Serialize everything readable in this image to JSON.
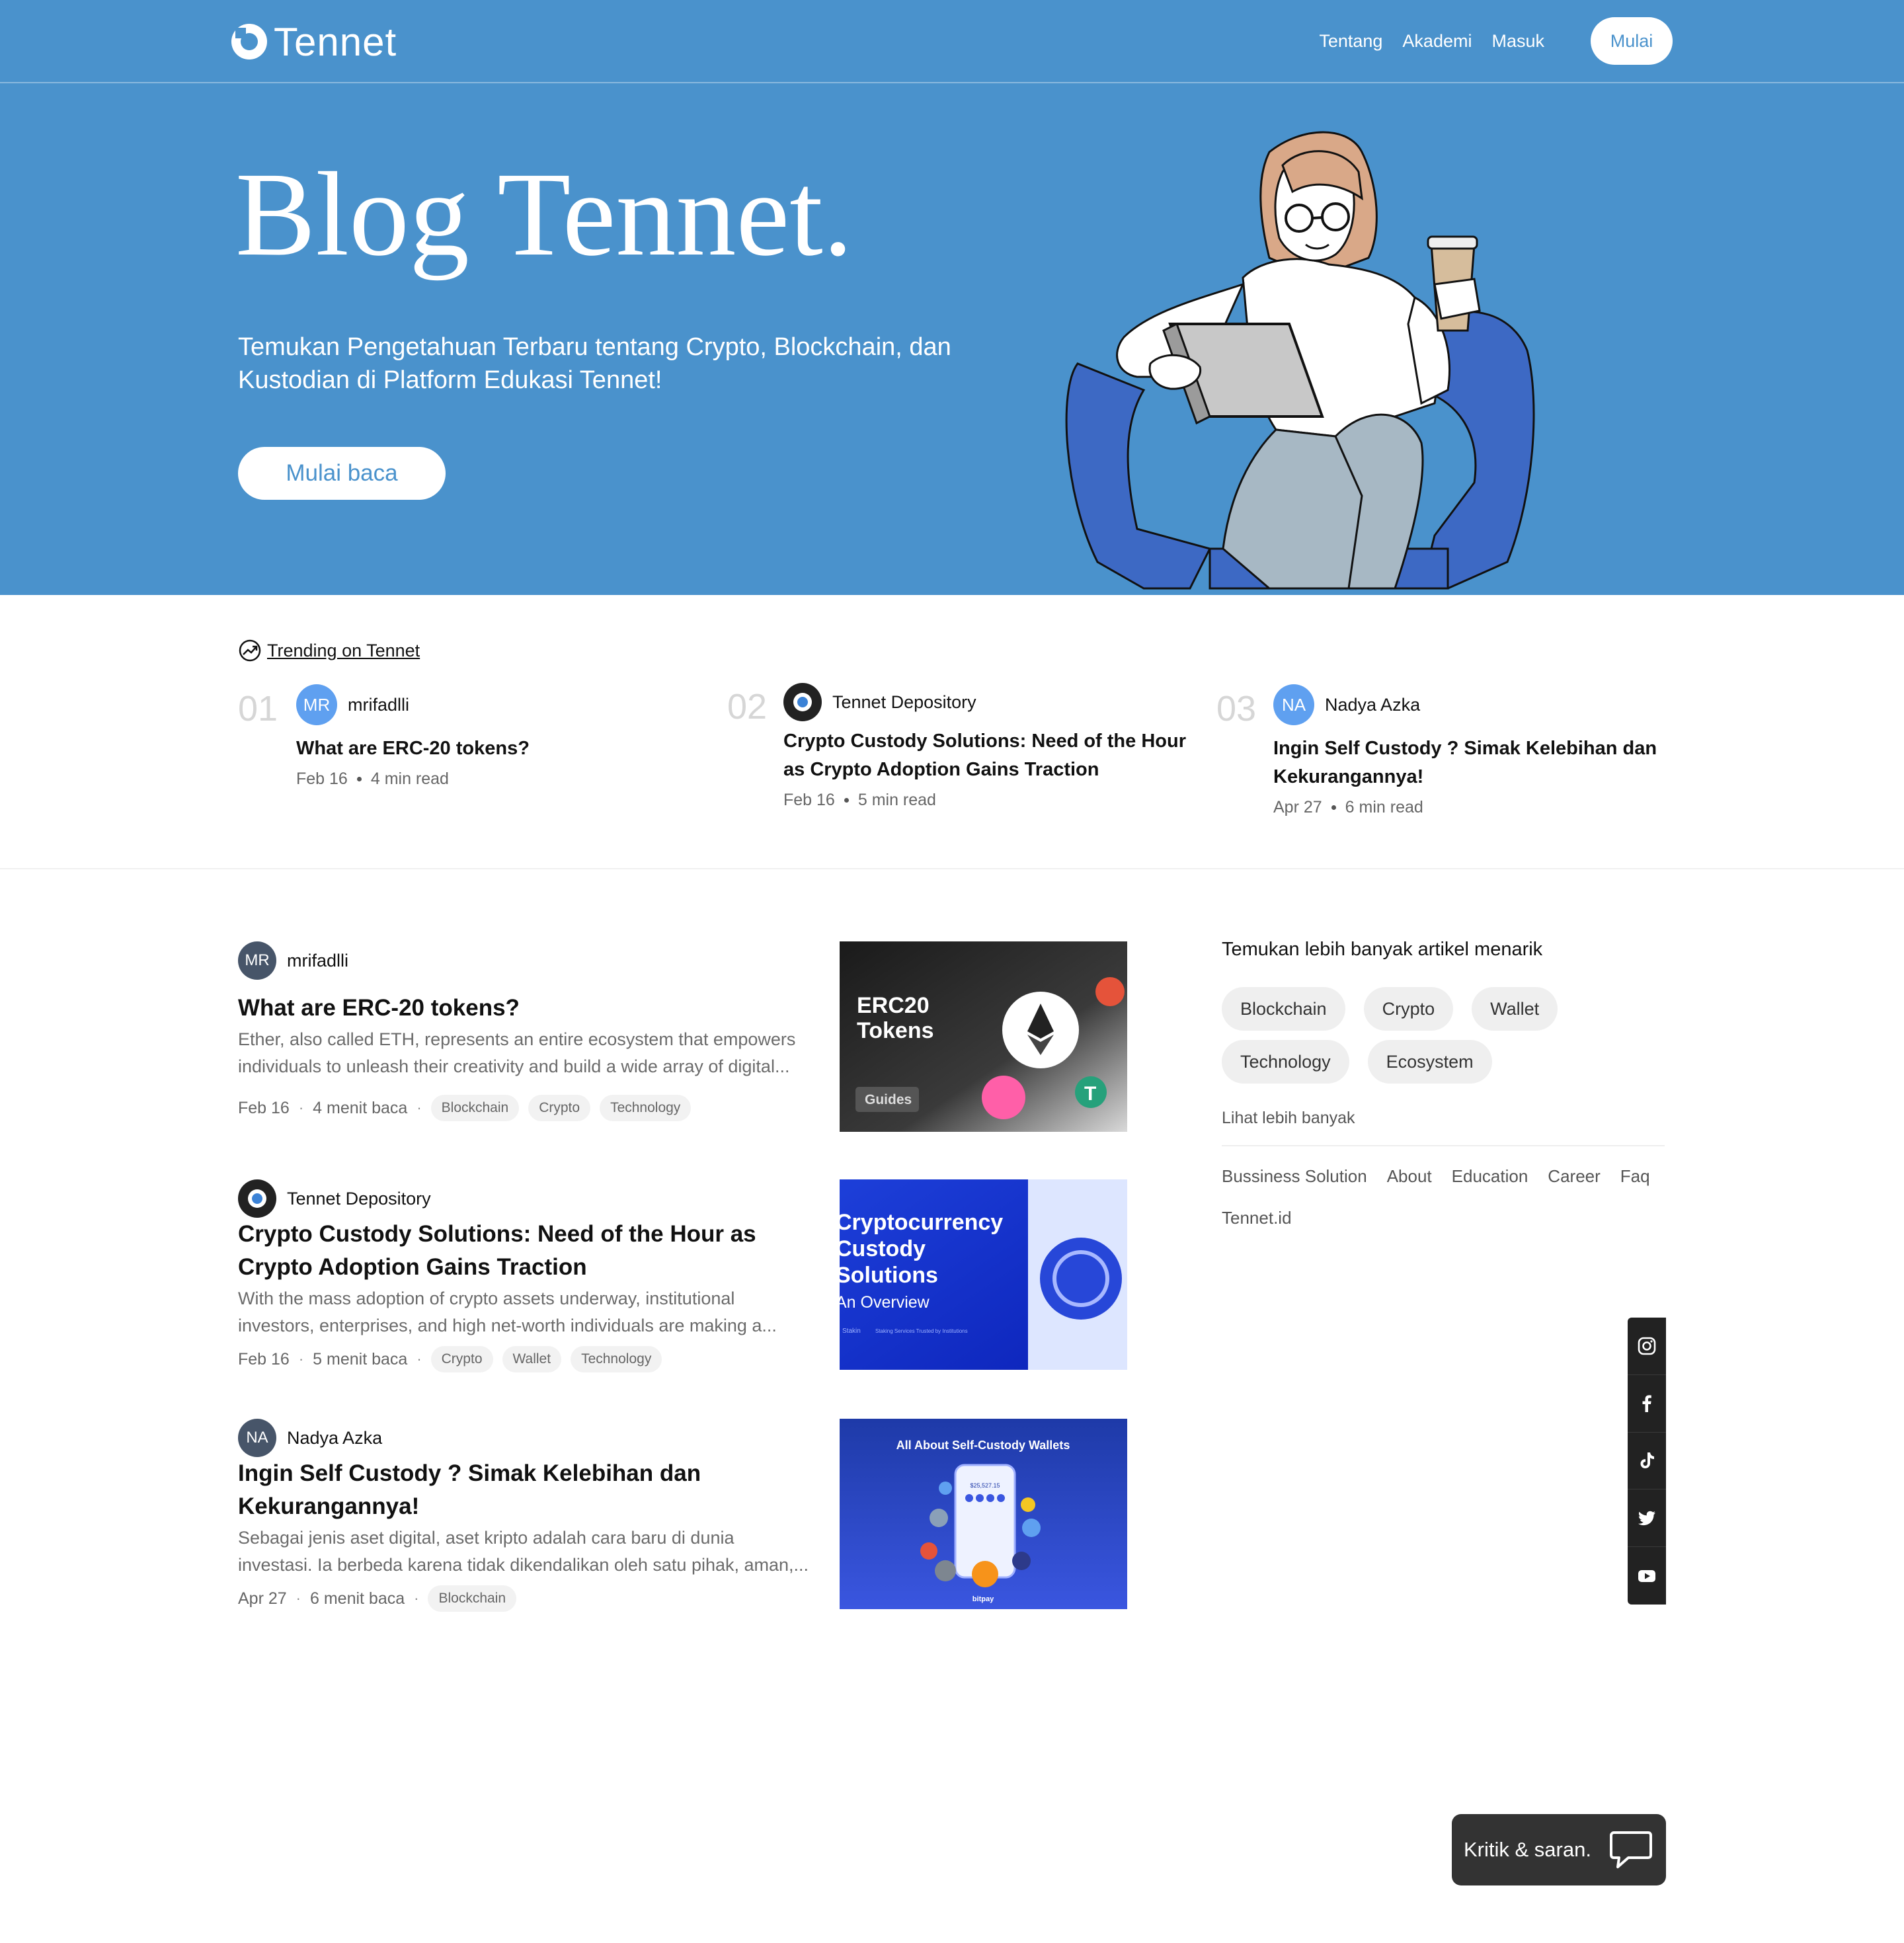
{
  "brand": {
    "name": "Tennet",
    "accent": "#4a92cc"
  },
  "nav": {
    "links": [
      "Tentang",
      "Akademi",
      "Masuk"
    ],
    "cta": "Mulai"
  },
  "hero": {
    "title": "Blog Tennet.",
    "subtitle": "Temukan Pengetahuan Terbaru tentang Crypto, Blockchain, dan Kustodian di Platform Edukasi Tennet!",
    "cta": "Mulai baca"
  },
  "trending": {
    "label": "Trending on Tennet",
    "items": [
      {
        "num": "01",
        "avatar": "MR",
        "author": "mrifadlli",
        "title": "What are ERC-20 tokens?",
        "date": "Feb 16",
        "read": "4 min read"
      },
      {
        "num": "02",
        "avatar": "",
        "author": "Tennet Depository",
        "title": "Crypto Custody Solutions: Need of the Hour as Crypto Adoption Gains Traction",
        "date": "Feb 16",
        "read": "5 min read"
      },
      {
        "num": "03",
        "avatar": "NA",
        "author": "Nadya Azka",
        "title": "Ingin Self Custody ? Simak Kelebihan dan Kekurangannya!",
        "date": "Apr 27",
        "read": "6 min read"
      }
    ]
  },
  "articles": [
    {
      "avatar": "MR",
      "author": "mrifadlli",
      "title": "What are ERC-20 tokens?",
      "excerpt": "Ether, also called ETH, represents an entire ecosystem that empowers individuals to unleash their creativity and build a wide array of digital...",
      "date": "Feb 16",
      "read": "4 menit baca",
      "tags": [
        "Blockchain",
        "Crypto",
        "Technology"
      ],
      "thumb": {
        "line1": "ERC20",
        "line2": "Tokens",
        "badge": "Guides"
      }
    },
    {
      "avatar": "",
      "author": "Tennet Depository",
      "title": "Crypto Custody Solutions: Need of the Hour as Crypto Adoption Gains Traction",
      "excerpt": "With the mass adoption of crypto assets underway, institutional investors, enterprises, and high net-worth individuals are making a...",
      "date": "Feb 16",
      "read": "5 menit baca",
      "tags": [
        "Crypto",
        "Wallet",
        "Technology"
      ],
      "thumb": {
        "line1": "Cryptocurrency",
        "line2": "Custody",
        "line3": "Solutions",
        "line4": "An Overview",
        "foot": "Stakin",
        "foot2": "Staking Services Trusted by Institutions"
      }
    },
    {
      "avatar": "NA",
      "author": "Nadya Azka",
      "title": "Ingin Self Custody ? Simak Kelebihan dan Kekurangannya!",
      "excerpt": "Sebagai jenis aset digital, aset kripto adalah cara baru di dunia investasi. Ia berbeda karena tidak dikendalikan oleh satu pihak, aman,...",
      "date": "Apr 27",
      "read": "6 menit baca",
      "tags": [
        "Blockchain"
      ],
      "thumb": {
        "title": "All About Self-Custody Wallets",
        "balance": "$25,527.15",
        "foot": "bitpay"
      }
    }
  ],
  "sidebar": {
    "title": "Temukan lebih banyak artikel menarik",
    "tags": [
      "Blockchain",
      "Crypto",
      "Wallet",
      "Technology",
      "Ecosystem"
    ],
    "more": "Lihat lebih banyak",
    "links": [
      "Bussiness Solution",
      "About",
      "Education",
      "Career",
      "Faq",
      "Tennet.id"
    ]
  },
  "social": [
    "instagram-icon",
    "facebook-icon",
    "tiktok-icon",
    "twitter-icon",
    "youtube-icon"
  ],
  "feedback": {
    "label": "Kritik & saran."
  }
}
